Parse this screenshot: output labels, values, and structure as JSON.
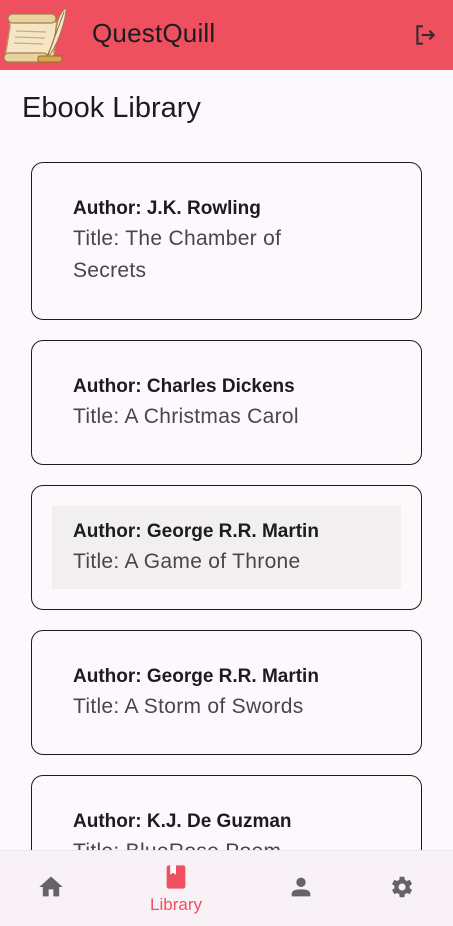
{
  "app": {
    "title": "QuestQuill",
    "colors": {
      "primary": "#ee5060",
      "text": "#1c1b1f",
      "muted": "#49454f",
      "background": "#fdf8fb"
    }
  },
  "header": {
    "logo_icon": "scroll-quill-logo",
    "logout_icon": "logout-icon"
  },
  "page": {
    "title": "Ebook Library"
  },
  "books": [
    {
      "author": "Author: J.K. Rowling",
      "title": "Title: The Chamber of Secrets"
    },
    {
      "author": "Author: Charles Dickens",
      "title": "Title: A Christmas Carol"
    },
    {
      "author": "Author: George R.R. Martin",
      "title": "Title: A Game of Throne"
    },
    {
      "author": "Author: George R.R. Martin",
      "title": "Title: A Storm of Swords"
    },
    {
      "author": "Author: K.J. De Guzman",
      "title": "Title: BlueRose Poem"
    }
  ],
  "bottom_nav": {
    "items": [
      {
        "icon": "home-icon",
        "label": ""
      },
      {
        "icon": "book-icon",
        "label": "Library",
        "active": true
      },
      {
        "icon": "person-icon",
        "label": ""
      },
      {
        "icon": "gear-icon",
        "label": ""
      }
    ]
  }
}
